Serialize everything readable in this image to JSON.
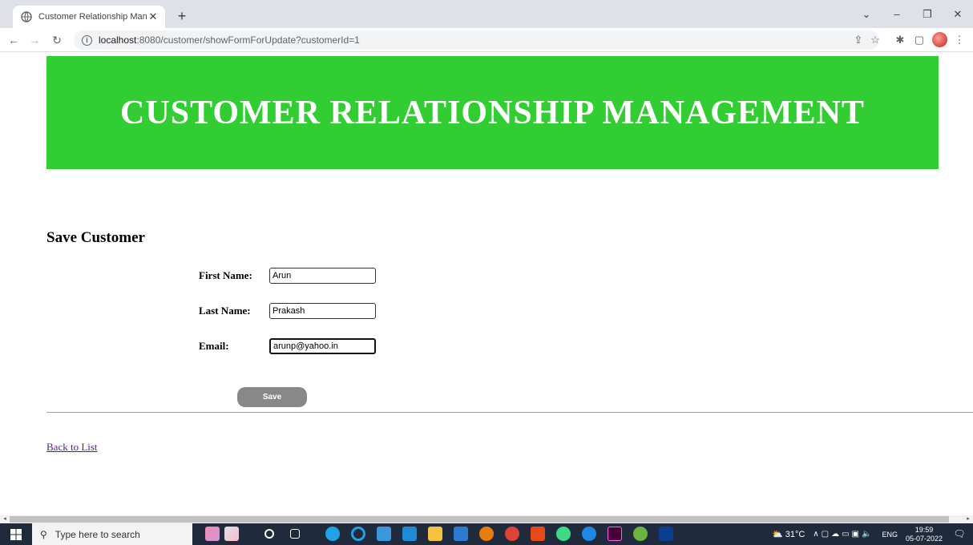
{
  "browser": {
    "tab_title": "Customer Relationship Managem",
    "url_host": "localhost",
    "url_path": ":8080/customer/showFormForUpdate?customerId=1"
  },
  "page": {
    "banner_title": "CUSTOMER RELATIONSHIP MANAGEMENT",
    "form_heading": "Save Customer",
    "fields": [
      {
        "label": "First Name:",
        "value": "Arun"
      },
      {
        "label": "Last Name:",
        "value": "Prakash"
      },
      {
        "label": "Email:",
        "value": "arunp@yahoo.in"
      }
    ],
    "save_label": "Save",
    "back_link": "Back to List"
  },
  "taskbar": {
    "search_placeholder": "Type here to search",
    "temperature": "31°C",
    "language": "ENG",
    "time": "19:59",
    "date": "05-07-2022"
  },
  "colors": {
    "banner": "#32cd32",
    "save_button": "#888888",
    "link": "#551a8b"
  }
}
